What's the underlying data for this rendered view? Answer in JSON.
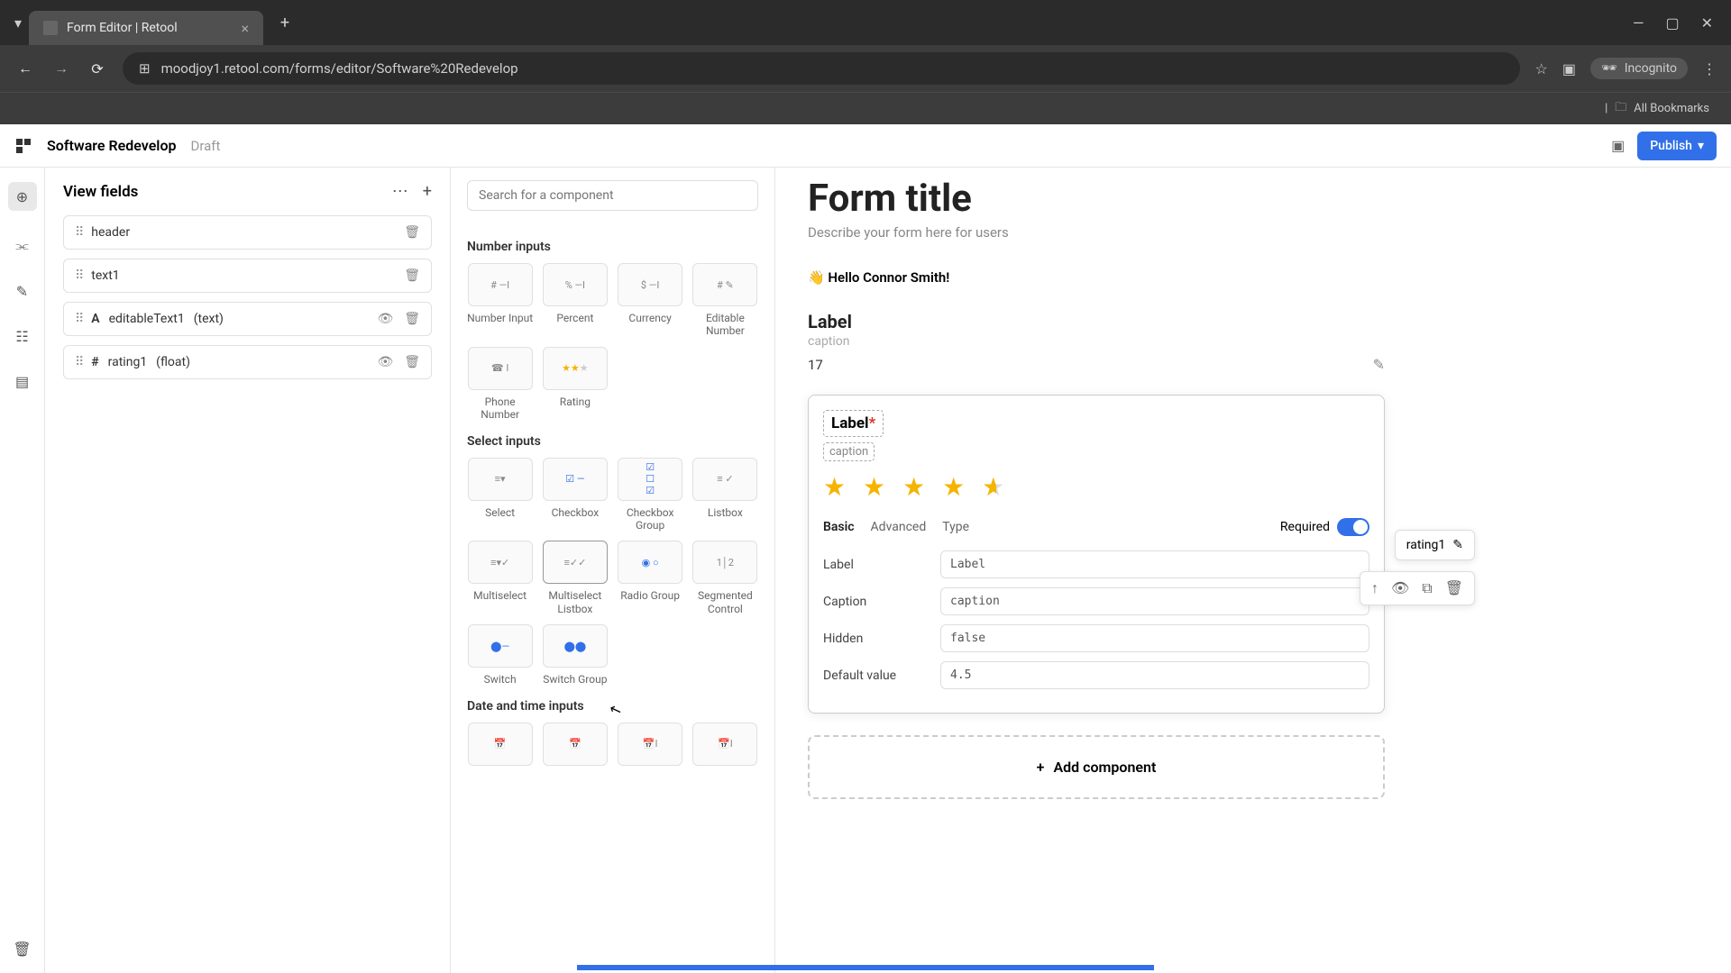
{
  "browser": {
    "tab_title": "Form Editor | Retool",
    "url": "moodjoy1.retool.com/forms/editor/Software%20Redevelop",
    "incognito_label": "Incognito",
    "bookmarks_label": "All Bookmarks"
  },
  "header": {
    "app_name": "Software Redevelop",
    "status": "Draft",
    "publish_label": "Publish"
  },
  "fields_panel": {
    "title": "View fields",
    "items": [
      {
        "name": "header",
        "icons": [
          "delete"
        ]
      },
      {
        "name": "text1",
        "icons": [
          "delete"
        ]
      },
      {
        "name": "editableText1",
        "type": "(text)",
        "type_icon": "A",
        "icons": [
          "hide",
          "delete"
        ]
      },
      {
        "name": "rating1",
        "type": "(float)",
        "type_icon": "#",
        "icons": [
          "hide",
          "delete"
        ]
      }
    ]
  },
  "picker": {
    "search_placeholder": "Search for a component",
    "sections": {
      "number": {
        "label": "Number inputs",
        "items": [
          "Number Input",
          "Percent",
          "Currency",
          "Editable Number",
          "Phone Number",
          "Rating"
        ]
      },
      "select": {
        "label": "Select inputs",
        "items": [
          "Select",
          "Checkbox",
          "Checkbox Group",
          "Listbox",
          "Multiselect",
          "Multiselect Listbox",
          "Radio Group",
          "Segmented Control",
          "Switch",
          "Switch Group"
        ]
      },
      "datetime": {
        "label": "Date and time inputs"
      }
    }
  },
  "canvas": {
    "form_title": "Form title",
    "form_desc": "Describe your form here for users",
    "greeting": "👋 Hello Connor Smith!",
    "label_block": {
      "label": "Label",
      "caption": "caption",
      "value": "17"
    },
    "selected": {
      "label": "Label",
      "caption": "caption",
      "rating": 4.5,
      "tabs": [
        "Basic",
        "Advanced",
        "Type"
      ],
      "required_label": "Required",
      "props": {
        "Label": "Label",
        "Caption": "caption",
        "Hidden": "false",
        "Default value": "4.5"
      }
    },
    "add_label": "Add component",
    "inspector_name": "rating1"
  }
}
